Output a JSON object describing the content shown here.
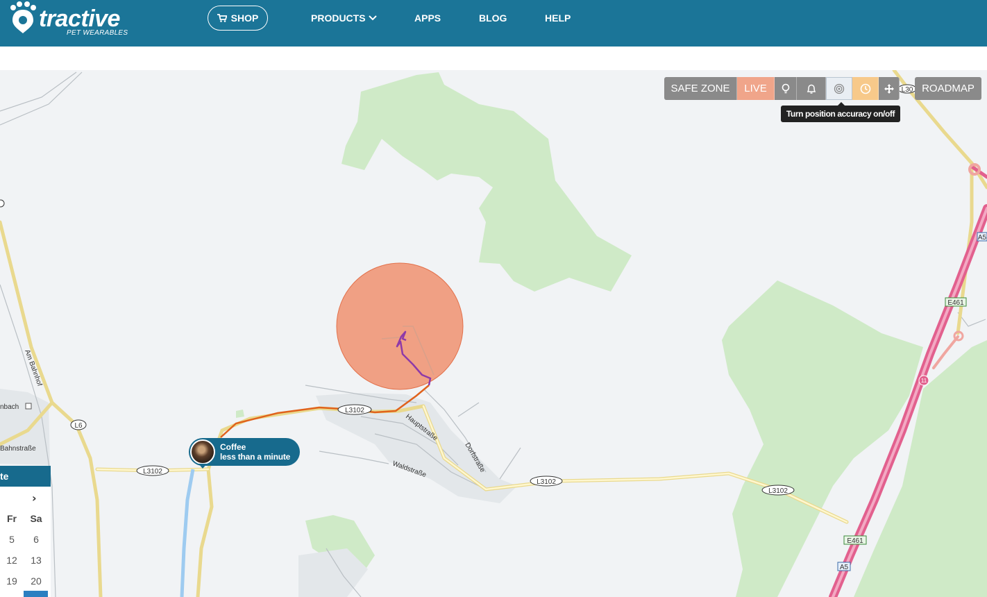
{
  "brand": {
    "name": "tractive",
    "tagline": "PET WEARABLES"
  },
  "nav": {
    "shop": "SHOP",
    "products": "PRODUCTS",
    "apps": "APPS",
    "blog": "BLOG",
    "help": "HELP"
  },
  "map_controls": {
    "safe_zone": "SAFE ZONE",
    "live": "LIVE",
    "roadmap": "ROADMAP",
    "tooltip": "Turn position accuracy on/off",
    "icons": [
      "lightbulb-icon",
      "bell-icon",
      "accuracy-target-icon",
      "history-clock-icon",
      "move-arrows-icon"
    ]
  },
  "map_labels": {
    "roads": [
      "L3102",
      "L3102",
      "L3102",
      "L3102",
      "L6",
      "L30",
      "E461",
      "E461",
      "A5",
      "A5",
      "11"
    ],
    "streets": [
      "Hauptstraße",
      "Dorfstraße",
      "Waldstraße",
      "Am Bahnhof",
      "Bahnstraße",
      "nbach"
    ]
  },
  "pet": {
    "name": "Coffee",
    "last_seen": "less than a minute"
  },
  "calendar": {
    "title": "te",
    "next": "›",
    "day_headers": [
      "Fr",
      "Sa"
    ],
    "rows": [
      [
        "5",
        "6"
      ],
      [
        "12",
        "13"
      ],
      [
        "19",
        "20"
      ]
    ]
  },
  "colors": {
    "header": "#1b7598",
    "accuracy_circle": "#f0a084",
    "track": "#8e3aa8",
    "live_route": "#e0621c",
    "forest": "#cdebc6",
    "motorway": "#e8709a"
  }
}
